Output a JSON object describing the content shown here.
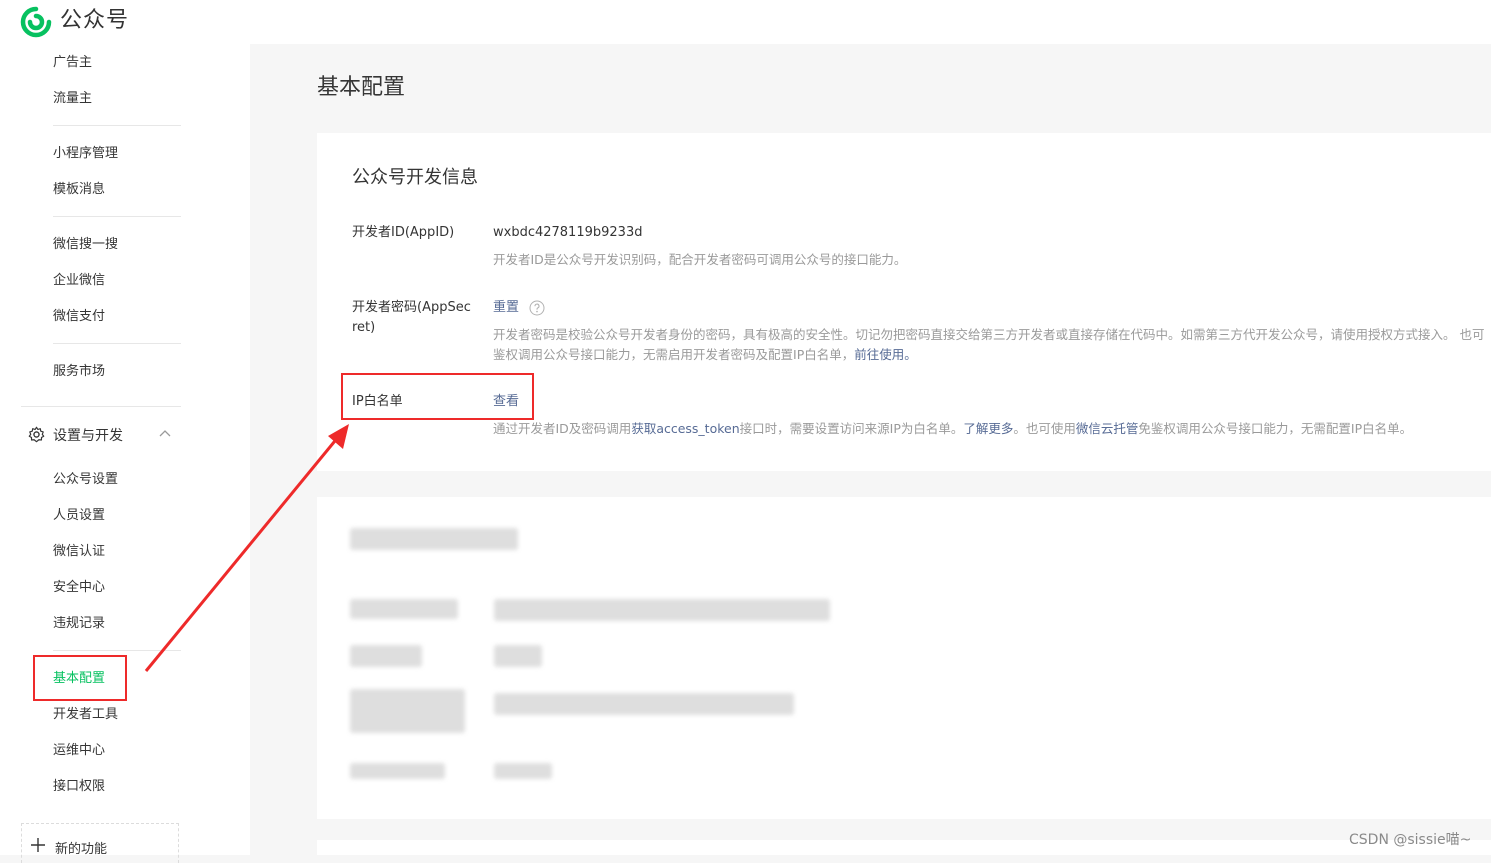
{
  "header": {
    "brand": "公众号"
  },
  "sidebar": {
    "group1": [
      "广告主",
      "流量主"
    ],
    "group2": [
      "小程序管理",
      "模板消息"
    ],
    "group3": [
      "微信搜一搜",
      "企业微信",
      "微信支付"
    ],
    "group4": [
      "服务市场"
    ],
    "section": {
      "label": "设置与开发"
    },
    "group5": [
      "公众号设置",
      "人员设置",
      "微信认证",
      "安全中心",
      "违规记录"
    ],
    "group6": [
      "基本配置",
      "开发者工具",
      "运维中心",
      "接口权限"
    ],
    "active_item": "基本配置",
    "new_feature": "新的功能"
  },
  "main": {
    "page_title": "基本配置",
    "card": {
      "title": "公众号开发信息",
      "appid": {
        "label": "开发者ID(AppID)",
        "value": "wxbdc4278119b9233d",
        "desc": "开发者ID是公众号开发识别码，配合开发者密码可调用公众号的接口能力。"
      },
      "appsecret": {
        "label_line1": "开发者密码(AppSec",
        "label_line2": "ret)",
        "action": "重置",
        "desc_line1": "开发者密码是校验公众号开发者身份的密码，具有极高的安全性。切记勿把密码直接交给第三方开发者或直接存储在代码中。如需第三方代开发公众号，请使用授权方式接入。 也可",
        "desc_line2_a": "鉴权调用公众号接口能力，无需启用开发者密码及配置IP白名单，",
        "desc_line2_link": "前往使用。"
      },
      "ip_whitelist": {
        "label": "IP白名单",
        "action": "查看",
        "desc_a": "通过开发者ID及密码调用",
        "desc_link1": "获取access_token",
        "desc_b": "接口时，需要设置访问来源IP为白名单。",
        "desc_link2": "了解更多",
        "desc_c": "。也可使用",
        "desc_link3": "微信云托管",
        "desc_d": "免鉴权调用公众号接口能力，无需配置IP白名单。"
      }
    }
  },
  "watermark": "CSDN @sissie喵~",
  "colors": {
    "accent": "#07c160",
    "link": "#576b95",
    "annotation": "#ee2a2a"
  }
}
